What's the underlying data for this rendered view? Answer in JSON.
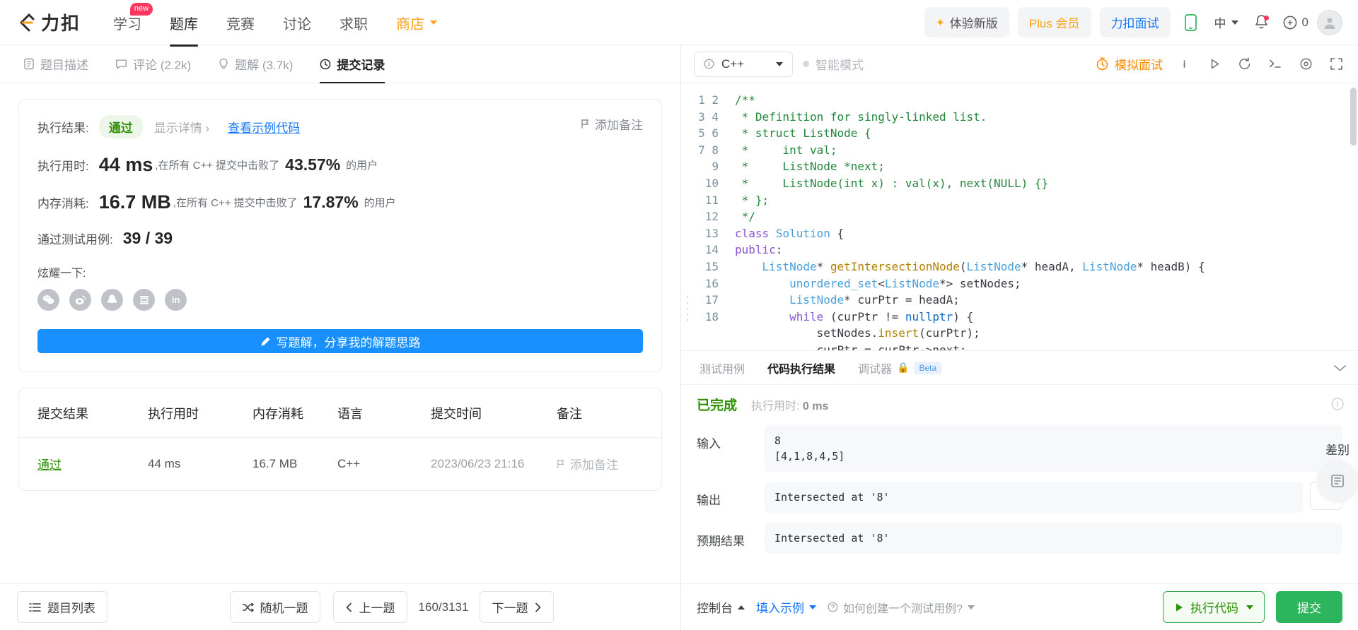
{
  "header": {
    "logo_text": "力扣",
    "nav": [
      {
        "label": "学习",
        "badge": "new",
        "active": false
      },
      {
        "label": "题库",
        "badge": "",
        "active": true
      },
      {
        "label": "竞赛",
        "badge": "",
        "active": false
      },
      {
        "label": "讨论",
        "badge": "",
        "active": false
      },
      {
        "label": "求职",
        "badge": "",
        "active": false
      },
      {
        "label": "商店",
        "badge": "",
        "active": false
      }
    ],
    "new_version": "体验新版",
    "plus": "Plus 会员",
    "interview": "力扣面试",
    "lang": "中",
    "coins": "0"
  },
  "left_tabs": [
    {
      "label": "题目描述",
      "icon": "document-icon",
      "active": false
    },
    {
      "label": "评论 (2.2k)",
      "icon": "comment-icon",
      "active": false
    },
    {
      "label": "题解 (3.7k)",
      "icon": "bulb-icon",
      "active": false
    },
    {
      "label": "提交记录",
      "icon": "clock-icon",
      "active": true
    }
  ],
  "result": {
    "result_label": "执行结果:",
    "status": "通过",
    "show_detail": "显示详情",
    "view_sample": "查看示例代码",
    "add_note": "添加备注",
    "runtime_label": "执行用时:",
    "runtime_value": "44 ms",
    "runtime_prefix": ",在所有 C++ 提交中击败了",
    "runtime_pct": "43.57%",
    "suffix_users": "的用户",
    "memory_label": "内存消耗:",
    "memory_value": "16.7 MB",
    "memory_prefix": ",在所有 C++ 提交中击败了",
    "memory_pct": "17.87%",
    "testcases_label": "通过测试用例:",
    "testcases_value": "39 / 39",
    "share_label": "炫耀一下:",
    "share_icons": [
      "wechat-icon",
      "weibo-icon",
      "qq-icon",
      "douban-icon",
      "linkedin-icon"
    ],
    "write_solution": "写题解，分享我的解题思路"
  },
  "table": {
    "headers": [
      "提交结果",
      "执行用时",
      "内存消耗",
      "语言",
      "提交时间",
      "备注"
    ],
    "rows": [
      {
        "status": "通过",
        "runtime": "44 ms",
        "memory": "16.7 MB",
        "language": "C++",
        "time": "2023/06/23 21:16",
        "note": "添加备注"
      }
    ]
  },
  "left_footer": {
    "problem_list": "题目列表",
    "random": "随机一题",
    "prev": "上一题",
    "page": "160/3131",
    "next": "下一题"
  },
  "editor": {
    "language": "C++",
    "smart_mode": "智能模式",
    "mock_interview": "模拟面试",
    "line_numbers": [
      1,
      2,
      3,
      4,
      5,
      6,
      7,
      8,
      9,
      10,
      11,
      12,
      13,
      14,
      15,
      16,
      17,
      18
    ],
    "code_lines": [
      "/**",
      " * Definition for singly-linked list.",
      " * struct ListNode {",
      " *     int val;",
      " *     ListNode *next;",
      " *     ListNode(int x) : val(x), next(NULL) {}",
      " * };",
      " */",
      "class Solution {",
      "public:",
      "    ListNode* getIntersectionNode(ListNode* headA, ListNode* headB) {",
      "        unordered_set<ListNode*> setNodes;",
      "        ListNode* curPtr = headA;",
      "        while (curPtr != nullptr) {",
      "            setNodes.insert(curPtr);",
      "            curPtr = curPtr->next;",
      "        }",
      ""
    ]
  },
  "test_panel": {
    "tabs": [
      {
        "label": "测试用例",
        "active": false,
        "beta": ""
      },
      {
        "label": "代码执行结果",
        "active": true,
        "beta": ""
      },
      {
        "label": "调试器",
        "active": false,
        "beta": "Beta"
      }
    ],
    "status": "已完成",
    "runtime_label": "执行用时:",
    "runtime_value": "0 ms",
    "input_label": "输入",
    "input_value": "8\n[4,1,8,4,5]",
    "output_label": "输出",
    "output_value": "Intersected at '8'",
    "expected_label": "预期结果",
    "expected_value": "Intersected at '8'",
    "diff_label": "差别"
  },
  "right_footer": {
    "console": "控制台",
    "fill_example": "填入示例",
    "how_to": "如何创建一个测试用例?",
    "run": "执行代码",
    "submit": "提交"
  }
}
